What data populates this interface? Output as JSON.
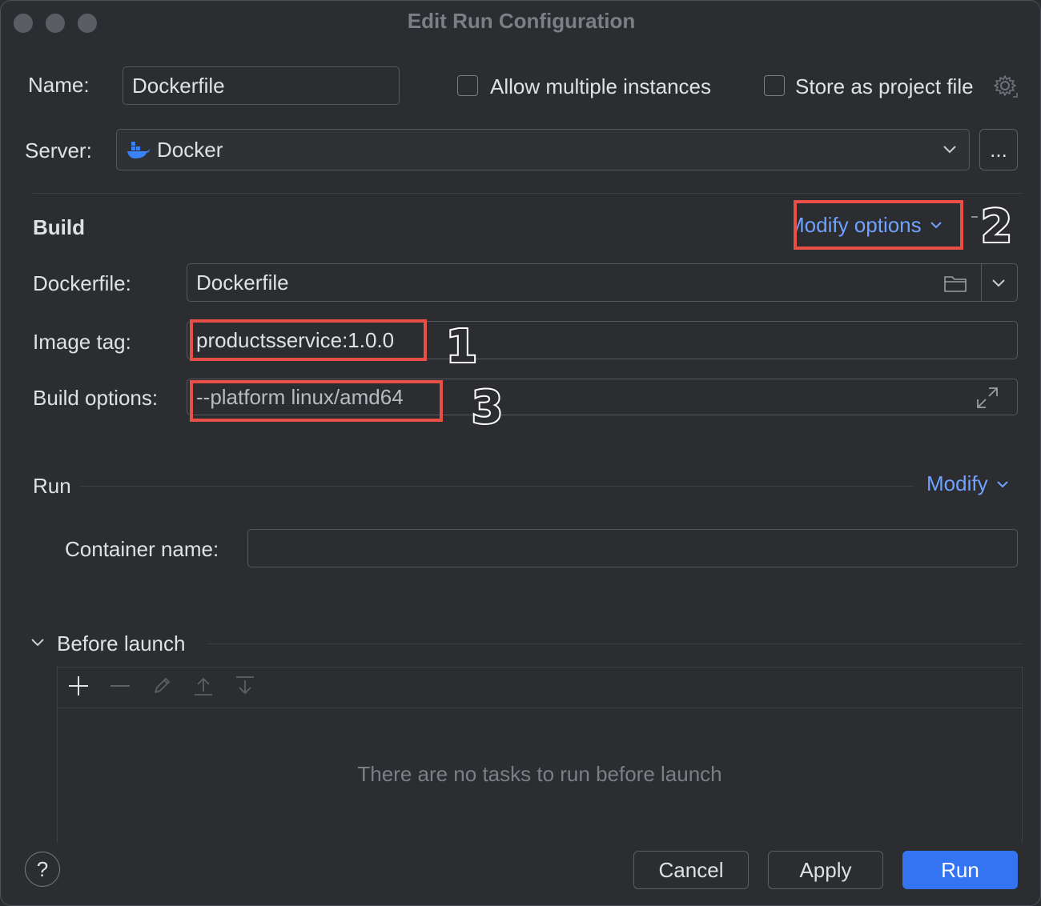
{
  "window": {
    "title": "Edit Run Configuration"
  },
  "name": {
    "label": "Name:",
    "value": "Dockerfile"
  },
  "allow_multiple": {
    "label": "Allow multiple instances",
    "checked": false
  },
  "store_project": {
    "label": "Store as project file",
    "checked": false
  },
  "server": {
    "label": "Server:",
    "value": "Docker",
    "more_label": "..."
  },
  "build": {
    "heading": "Build",
    "modify_label": "Modify options",
    "dockerfile_label": "Dockerfile:",
    "dockerfile_value": "Dockerfile",
    "image_tag_label": "Image tag:",
    "image_tag_value": "productsservice:1.0.0",
    "build_options_label": "Build options:",
    "build_options_value": "--platform linux/amd64"
  },
  "run": {
    "heading": "Run",
    "modify_label": "Modify",
    "container_name_label": "Container name:",
    "container_name_value": ""
  },
  "before_launch": {
    "heading": "Before launch",
    "empty_text": "There are no tasks to run before launch"
  },
  "annotations": {
    "one": "1",
    "two": "2",
    "three": "3"
  },
  "footer": {
    "help": "?",
    "cancel": "Cancel",
    "apply": "Apply",
    "run": "Run"
  },
  "colors": {
    "accent": "#3574f0",
    "link": "#6fa2ff",
    "annotation": "#ea4f45",
    "background": "#2b2d30"
  }
}
